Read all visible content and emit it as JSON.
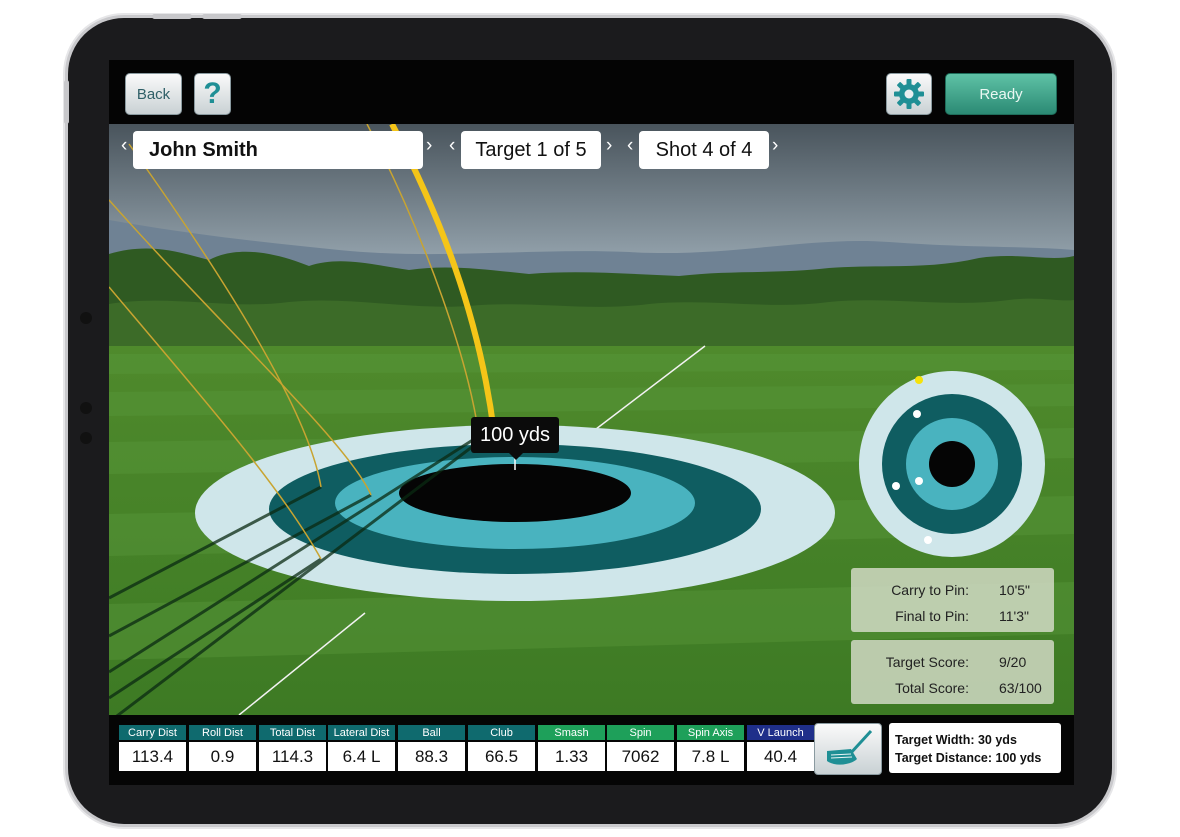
{
  "toolbar": {
    "back_label": "Back",
    "help_label": "?",
    "settings_icon": "gear-icon",
    "ready_label": "Ready"
  },
  "selectors": {
    "player": "John Smith",
    "target": "Target 1 of 5",
    "shot": "Shot 4 of 4",
    "prev_glyph": "‹",
    "next_glyph": "›"
  },
  "scene": {
    "distance_tooltip": "100 yds"
  },
  "pin_panel": {
    "carry_label": "Carry to Pin:",
    "carry_value": "10'5\"",
    "final_label": "Final to Pin:",
    "final_value": "11'3\""
  },
  "score_panel": {
    "target_label": "Target Score:",
    "target_value": "9/20",
    "total_label": "Total Score:",
    "total_value": "63/100"
  },
  "stats": [
    {
      "label": "Carry Dist",
      "value": "113.4",
      "color": "#0f6a6e"
    },
    {
      "label": "Roll Dist",
      "value": "0.9",
      "color": "#0f6a6e"
    },
    {
      "label": "Total Dist",
      "value": "114.3",
      "color": "#0f6a6e"
    },
    {
      "label": "Lateral Dist",
      "value": "6.4 L",
      "color": "#0f6a6e"
    },
    {
      "label": "Ball",
      "value": "88.3",
      "color": "#0f6a6e"
    },
    {
      "label": "Club",
      "value": "66.5",
      "color": "#0f6a6e"
    },
    {
      "label": "Smash",
      "value": "1.33",
      "color": "#1ea05a"
    },
    {
      "label": "Spin",
      "value": "7062",
      "color": "#1ea05a"
    },
    {
      "label": "Spin Axis",
      "value": "7.8 L",
      "color": "#1ea05a"
    },
    {
      "label": "V Launch",
      "value": "40.4",
      "color": "#1f2f8a"
    }
  ],
  "club_icon": "golf-club-icon",
  "target_info": {
    "width": "Target Width: 30 yds",
    "distance": "Target Distance: 100 yds"
  },
  "colors": {
    "ring_outer": "#cfe6ea",
    "ring_dark": "#0f5d61",
    "ring_mid": "#49b3bf",
    "bullseye": "#050505",
    "ready_accent": "#3aa88a",
    "shot_trace": "#f5c518"
  }
}
